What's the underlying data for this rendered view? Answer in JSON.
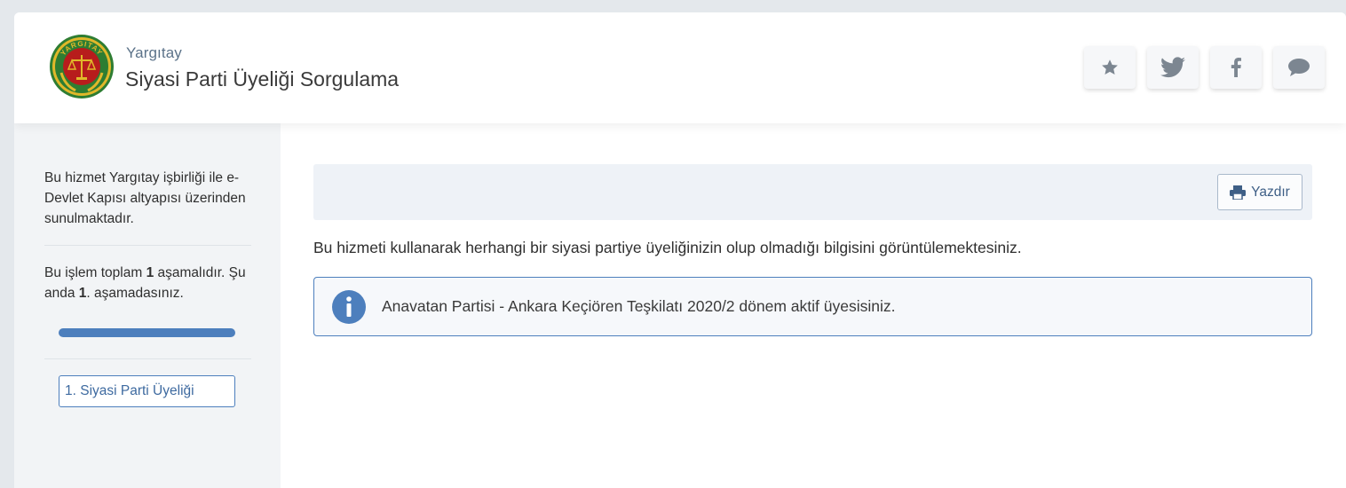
{
  "header": {
    "org_name": "Yargıtay",
    "service_title": "Siyasi Parti Üyeliği Sorgulama",
    "logo_text": "YARGITAY",
    "buttons": [
      {
        "icon": "star-icon"
      },
      {
        "icon": "twitter-icon"
      },
      {
        "icon": "facebook-icon"
      },
      {
        "icon": "chat-icon"
      }
    ]
  },
  "sidebar": {
    "intro": "Bu hizmet Yargıtay işbirliği ile e-Devlet Kapısı altyapısı üzerinden sunulmaktadır.",
    "stage_prefix": "Bu işlem toplam ",
    "stage_total": "1",
    "stage_middle": " aşamalıdır. Şu anda ",
    "stage_current": "1",
    "stage_suffix": ". aşamadasınız.",
    "progress": 1.0,
    "steps": [
      "1. Siyasi Parti Üyeliği"
    ]
  },
  "main": {
    "print_label": "Yazdır",
    "intro": "Bu hizmeti kullanarak herhangi bir siyasi partiye üyeliğinizin olup olmadığı bilgisini görüntülemektesiniz.",
    "result": "Anavatan Partisi - Ankara Keçiören Teşkilatı 2020/2 dönem aktif üyesisiniz."
  },
  "colors": {
    "accent": "#4d7fbd",
    "sidebar_bg": "#f2f4f6",
    "toolbar_bg": "#eef2f7",
    "logo_green": "#2e7d32",
    "logo_red": "#b71c1c",
    "logo_gold": "#d4a017"
  }
}
